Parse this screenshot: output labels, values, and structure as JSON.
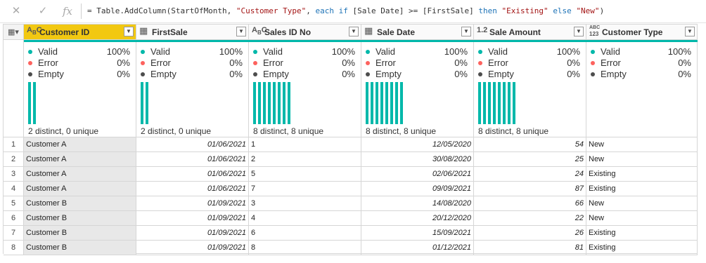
{
  "formula_bar": {
    "fx_label": "fx",
    "seg1": "= Table.AddColumn(StartOfMonth, ",
    "seg2": "\"Customer Type\"",
    "seg3": ", ",
    "seg4": "each",
    "seg5": " ",
    "seg6": "if",
    "seg7": " [Sale Date] >= [FirstSale] ",
    "seg8": "then",
    "seg9": " ",
    "seg10": "\"Existing\"",
    "seg11": " ",
    "seg12": "else",
    "seg13": " ",
    "seg14": "\"New\"",
    "seg15": ")"
  },
  "profile_labels": {
    "valid": "Valid",
    "error": "Error",
    "empty": "Empty"
  },
  "colors": {
    "valid": "#01b8aa",
    "error": "#fd625e",
    "empty": "#4d4d4d",
    "selected_header": "#f2c811"
  },
  "columns": [
    {
      "name": "Customer ID",
      "type_icon": "AᴬC",
      "selected": true,
      "align": "left",
      "valid": "100%",
      "error": "0%",
      "empty": "0%",
      "distinct_label": "2 distinct, 0 unique",
      "bar_count": 2
    },
    {
      "name": "FirstSale",
      "type_icon": "calendar-icon",
      "selected": false,
      "align": "right",
      "valid": "100%",
      "error": "0%",
      "empty": "0%",
      "distinct_label": "2 distinct, 0 unique",
      "bar_count": 2
    },
    {
      "name": "Sales ID No",
      "type_icon": "AᴬC",
      "selected": false,
      "align": "left",
      "valid": "100%",
      "error": "0%",
      "empty": "0%",
      "distinct_label": "8 distinct, 8 unique",
      "bar_count": 8
    },
    {
      "name": "Sale Date",
      "type_icon": "calendar-icon",
      "selected": false,
      "align": "right",
      "valid": "100%",
      "error": "0%",
      "empty": "0%",
      "distinct_label": "8 distinct, 8 unique",
      "bar_count": 8
    },
    {
      "name": "Sale Amount",
      "type_icon": "1.2",
      "selected": false,
      "align": "right",
      "valid": "100%",
      "error": "0%",
      "empty": "0%",
      "distinct_label": "8 distinct, 8 unique",
      "bar_count": 8
    },
    {
      "name": "Customer Type",
      "type_icon": "ABC 123",
      "selected": false,
      "align": "left",
      "valid": "100%",
      "error": "0%",
      "empty": "0%",
      "distinct_label": "",
      "bar_count": 0
    }
  ],
  "rows": [
    {
      "n": "1",
      "cells": [
        "Customer A",
        "01/06/2021",
        "1",
        "12/05/2020",
        "54",
        "New"
      ]
    },
    {
      "n": "2",
      "cells": [
        "Customer A",
        "01/06/2021",
        "2",
        "30/08/2020",
        "25",
        "New"
      ]
    },
    {
      "n": "3",
      "cells": [
        "Customer A",
        "01/06/2021",
        "5",
        "02/06/2021",
        "24",
        "Existing"
      ]
    },
    {
      "n": "4",
      "cells": [
        "Customer A",
        "01/06/2021",
        "7",
        "09/09/2021",
        "87",
        "Existing"
      ]
    },
    {
      "n": "5",
      "cells": [
        "Customer B",
        "01/09/2021",
        "3",
        "14/08/2020",
        "66",
        "New"
      ]
    },
    {
      "n": "6",
      "cells": [
        "Customer B",
        "01/09/2021",
        "4",
        "20/12/2020",
        "22",
        "New"
      ]
    },
    {
      "n": "7",
      "cells": [
        "Customer B",
        "01/09/2021",
        "6",
        "15/09/2021",
        "26",
        "Existing"
      ]
    },
    {
      "n": "8",
      "cells": [
        "Customer B",
        "01/09/2021",
        "8",
        "01/12/2021",
        "81",
        "Existing"
      ]
    }
  ]
}
